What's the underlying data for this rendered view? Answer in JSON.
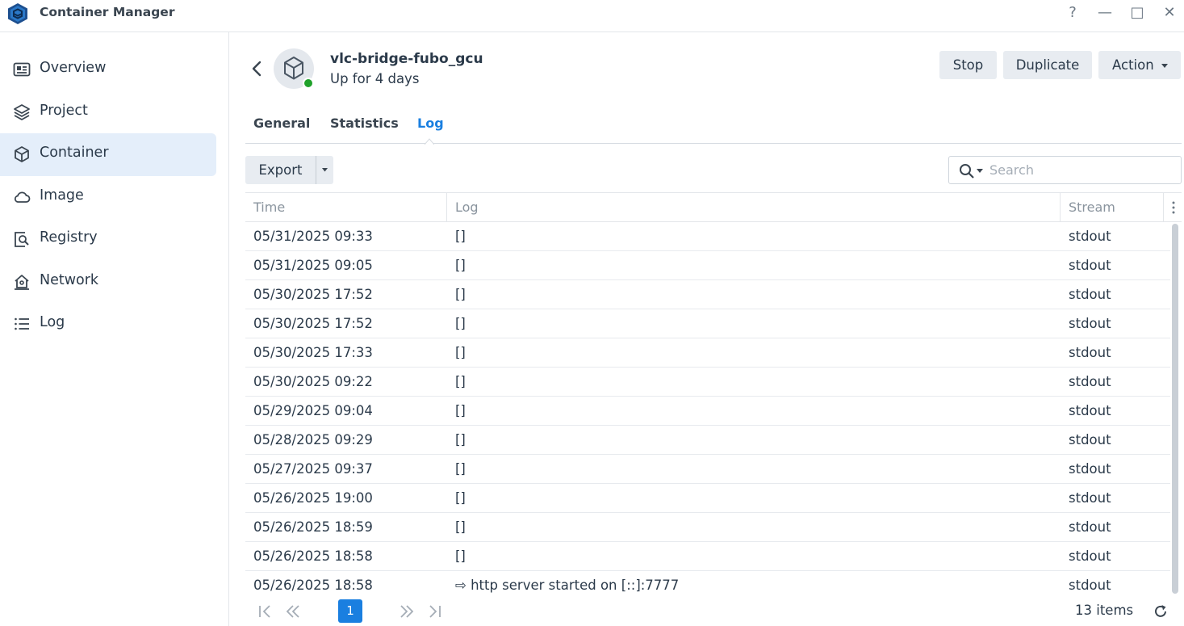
{
  "app": {
    "title": "Container Manager"
  },
  "window_controls": {
    "help": "?",
    "minimize": "—",
    "maximize": "□",
    "close": "✕"
  },
  "sidebar": {
    "items": [
      {
        "label": "Overview",
        "icon": "overview-icon",
        "active": false
      },
      {
        "label": "Project",
        "icon": "layers-icon",
        "active": false
      },
      {
        "label": "Container",
        "icon": "cube-icon",
        "active": true
      },
      {
        "label": "Image",
        "icon": "cloud-icon",
        "active": false
      },
      {
        "label": "Registry",
        "icon": "registry-search-icon",
        "active": false
      },
      {
        "label": "Network",
        "icon": "network-house-icon",
        "active": false
      },
      {
        "label": "Log",
        "icon": "list-icon",
        "active": false
      }
    ]
  },
  "header": {
    "name": "vlc-bridge-fubo_gcu",
    "status": "Up for 4 days",
    "status_color": "#1fa12a",
    "buttons": {
      "stop": "Stop",
      "duplicate": "Duplicate",
      "action": "Action"
    }
  },
  "tabs": [
    {
      "label": "General",
      "active": false
    },
    {
      "label": "Statistics",
      "active": false
    },
    {
      "label": "Log",
      "active": true
    }
  ],
  "toolbar": {
    "export_label": "Export",
    "search_placeholder": "Search"
  },
  "table": {
    "columns": [
      "Time",
      "Log",
      "Stream"
    ],
    "rows": [
      {
        "time": "05/31/2025 09:33",
        "log": "[]",
        "stream": "stdout"
      },
      {
        "time": "05/31/2025 09:05",
        "log": "[]",
        "stream": "stdout"
      },
      {
        "time": "05/30/2025 17:52",
        "log": "[]",
        "stream": "stdout"
      },
      {
        "time": "05/30/2025 17:52",
        "log": "[]",
        "stream": "stdout"
      },
      {
        "time": "05/30/2025 17:33",
        "log": "[]",
        "stream": "stdout"
      },
      {
        "time": "05/30/2025 09:22",
        "log": "[]",
        "stream": "stdout"
      },
      {
        "time": "05/29/2025 09:04",
        "log": "[]",
        "stream": "stdout"
      },
      {
        "time": "05/28/2025 09:29",
        "log": "[]",
        "stream": "stdout"
      },
      {
        "time": "05/27/2025 09:37",
        "log": "[]",
        "stream": "stdout"
      },
      {
        "time": "05/26/2025 19:00",
        "log": "[]",
        "stream": "stdout"
      },
      {
        "time": "05/26/2025 18:59",
        "log": "[]",
        "stream": "stdout"
      },
      {
        "time": "05/26/2025 18:58",
        "log": "[]",
        "stream": "stdout"
      },
      {
        "time": "05/26/2025 18:58",
        "log": "⇨ http server started on [::]:7777",
        "stream": "stdout"
      }
    ]
  },
  "pager": {
    "current_page": "1",
    "item_count": "13 items"
  },
  "colors": {
    "accent": "#1a7fe0",
    "active_nav_bg": "#e4eefa",
    "button_bg": "#e8ecf1"
  }
}
